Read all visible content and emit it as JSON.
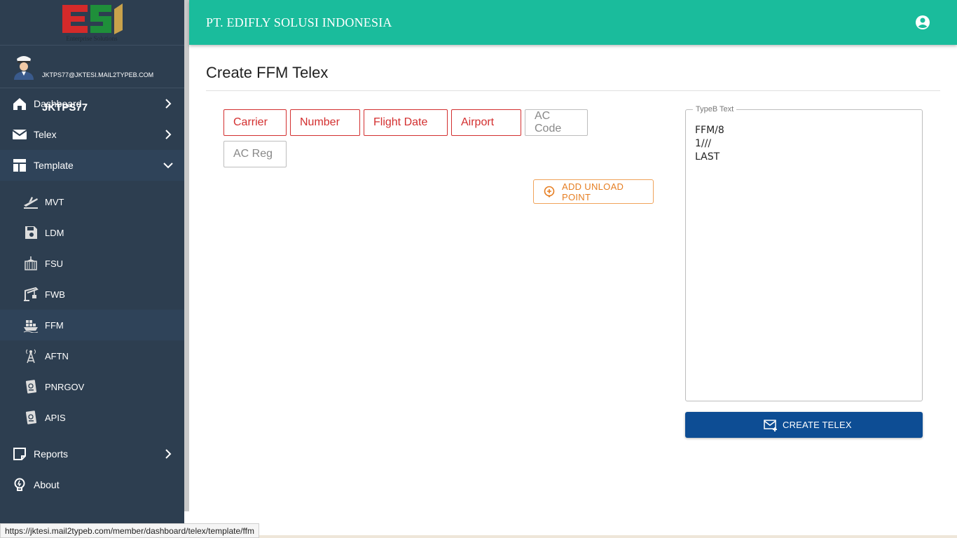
{
  "logo": {
    "subtitle": "Enterprise Solutions",
    "colors": {
      "red": "#d42a2a",
      "green": "#1f8f3a",
      "gold": "#c9a24b"
    }
  },
  "user": {
    "name": "JKTPS77",
    "email": "JKTPS77@JKTESI.MAIL2TYPEB.COM"
  },
  "nav": {
    "dashboard": "Dashboard",
    "telex": "Telex",
    "template": "Template",
    "sub": [
      "MVT",
      "LDM",
      "FSU",
      "FWB",
      "FFM",
      "AFTN",
      "PNRGOV",
      "APIS"
    ],
    "active_sub": "FFM",
    "reports": "Reports",
    "about": "About"
  },
  "topbar": {
    "brand": "PT. EDIFLY SOLUSI INDONESIA",
    "bg_color": "#1abc9c"
  },
  "page": {
    "title": "Create FFM Telex"
  },
  "form": {
    "carrier": "Carrier",
    "number": "Number",
    "flight_date": "Flight Date",
    "airport": "Airport",
    "ac_code": "AC Code",
    "ac_reg": "AC Reg",
    "add_unload_label": "ADD UNLOAD POINT",
    "error_color": "#d32f2f"
  },
  "typeb": {
    "legend": "TypeB Text",
    "content": "FFM/8\n1///\nLAST"
  },
  "create_button": {
    "label": "CREATE TELEX",
    "color": "#0d4d94"
  },
  "status_bar": {
    "url": "https://jktesi.mail2typeb.com/member/dashboard/telex/template/ffm"
  }
}
